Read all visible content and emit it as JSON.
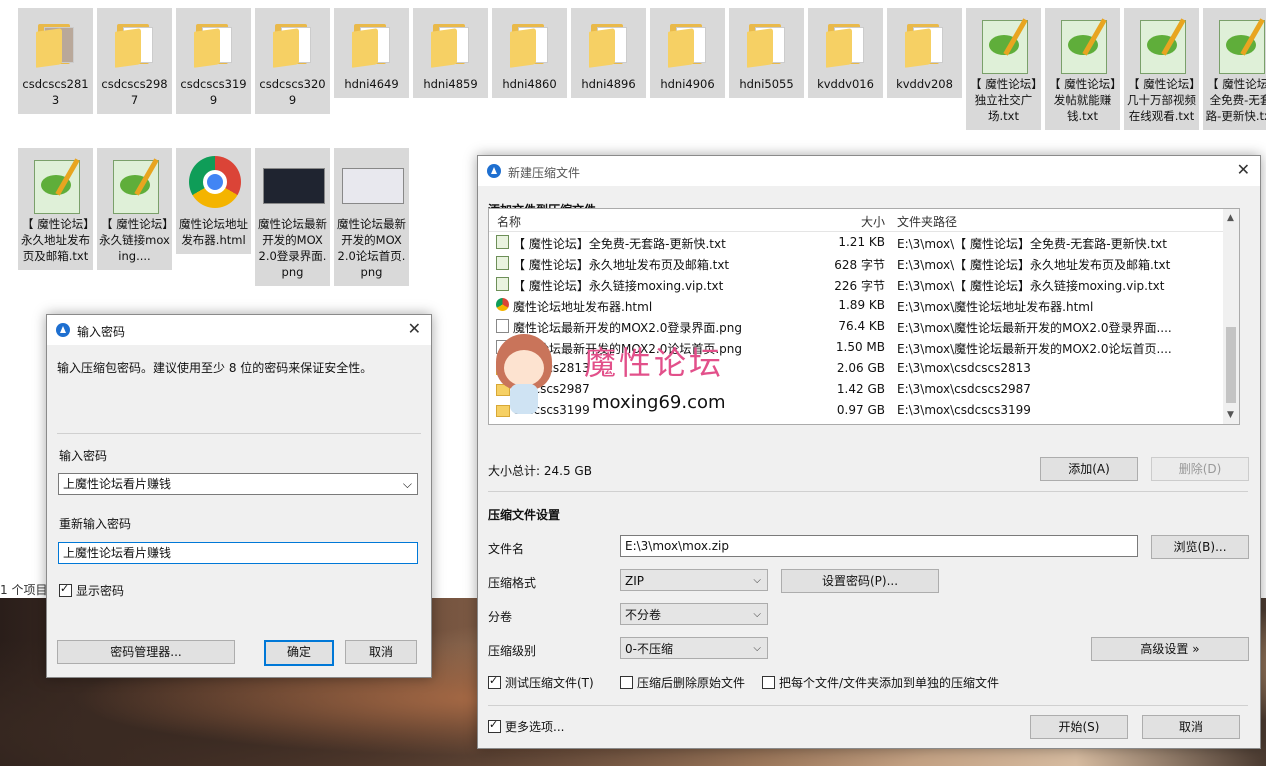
{
  "explorer": {
    "row1": [
      {
        "label": "csdcscs2813",
        "type": "folder-photo"
      },
      {
        "label": "csdcscs2987",
        "type": "folder"
      },
      {
        "label": "csdcscs3199",
        "type": "folder"
      },
      {
        "label": "csdcscs3209",
        "type": "folder"
      },
      {
        "label": "hdni4649",
        "type": "folder"
      },
      {
        "label": "hdni4859",
        "type": "folder"
      },
      {
        "label": "hdni4860",
        "type": "folder"
      },
      {
        "label": "hdni4896",
        "type": "folder"
      },
      {
        "label": "hdni4906",
        "type": "folder"
      },
      {
        "label": "hdni5055",
        "type": "folder"
      },
      {
        "label": "kvddv016",
        "type": "folder"
      },
      {
        "label": "kvddv208",
        "type": "folder"
      },
      {
        "label": "【 魔性论坛】独立社交广场.txt",
        "type": "notepad"
      },
      {
        "label": "【 魔性论坛】发帖就能赚钱.txt",
        "type": "notepad"
      },
      {
        "label": "【 魔性论坛】几十万部视频在线观看.txt",
        "type": "notepad"
      },
      {
        "label": "【 魔性论坛】全免费-无套路-更新快.txt",
        "type": "notepad"
      }
    ],
    "row2": [
      {
        "label": "【 魔性论坛】永久地址发布页及邮箱.txt",
        "type": "notepad"
      },
      {
        "label": "【 魔性论坛】永久链接moxing....",
        "type": "notepad"
      },
      {
        "label": "魔性论坛地址发布器.html",
        "type": "chrome"
      },
      {
        "label": "魔性论坛最新开发的MOX2.0登录界面.png",
        "type": "shot-dark"
      },
      {
        "label": "魔性论坛最新开发的MOX2.0论坛首页.png",
        "type": "shot-light"
      }
    ],
    "status_count": "1 个项目"
  },
  "password_dialog": {
    "title": "输入密码",
    "description": "输入压缩包密码。建议使用至少 8 位的密码来保证安全性。",
    "password_label": "输入密码",
    "password_value": "上魔性论坛看片赚钱",
    "reenter_label": "重新输入密码",
    "reenter_value": "上魔性论坛看片赚钱",
    "show_password_label": "显示密码",
    "show_password_checked": true,
    "manager_button": "密码管理器...",
    "ok_button": "确定",
    "cancel_button": "取消"
  },
  "archive_dialog": {
    "title": "新建压缩文件",
    "section_add": "添加文件到压缩文件",
    "columns": {
      "name": "名称",
      "size": "大小",
      "path": "文件夹路径"
    },
    "files": [
      {
        "icon": "txt",
        "name": "【 魔性论坛】全免费-无套路-更新快.txt",
        "size": "1.21 KB",
        "path": "E:\\3\\mox\\【 魔性论坛】全免费-无套路-更新快.txt"
      },
      {
        "icon": "txt",
        "name": "【 魔性论坛】永久地址发布页及邮箱.txt",
        "size": "628 字节",
        "path": "E:\\3\\mox\\【 魔性论坛】永久地址发布页及邮箱.txt"
      },
      {
        "icon": "txt",
        "name": "【 魔性论坛】永久链接moxing.vip.txt",
        "size": "226 字节",
        "path": "E:\\3\\mox\\【 魔性论坛】永久链接moxing.vip.txt"
      },
      {
        "icon": "html",
        "name": "魔性论坛地址发布器.html",
        "size": "1.89 KB",
        "path": "E:\\3\\mox\\魔性论坛地址发布器.html"
      },
      {
        "icon": "png",
        "name": "魔性论坛最新开发的MOX2.0登录界面.png",
        "size": "76.4 KB",
        "path": "E:\\3\\mox\\魔性论坛最新开发的MOX2.0登录界面...."
      },
      {
        "icon": "png",
        "name": "魔性论坛最新开发的MOX2.0论坛首页.png",
        "size": "1.50 MB",
        "path": "E:\\3\\mox\\魔性论坛最新开发的MOX2.0论坛首页...."
      },
      {
        "icon": "folder",
        "name": "csdcscs2813",
        "size": "2.06 GB",
        "path": "E:\\3\\mox\\csdcscs2813"
      },
      {
        "icon": "folder",
        "name": "csdcscs2987",
        "size": "1.42 GB",
        "path": "E:\\3\\mox\\csdcscs2987"
      },
      {
        "icon": "folder",
        "name": "csdcscs3199",
        "size": "0.97 GB",
        "path": "E:\\3\\mox\\csdcscs3199"
      }
    ],
    "total_size": "大小总计: 24.5 GB",
    "add_button": "添加(A)",
    "delete_button": "删除(D)",
    "section_settings": "压缩文件设置",
    "filename_label": "文件名",
    "filename_value": "E:\\3\\mox\\mox.zip",
    "browse_button": "浏览(B)...",
    "format_label": "压缩格式",
    "format_value": "ZIP",
    "set_password_button": "设置密码(P)...",
    "volume_label": "分卷",
    "volume_value": "不分卷",
    "level_label": "压缩级别",
    "level_value": "0-不压缩",
    "advanced_button": "高级设置 »",
    "test_archive_label": "测试压缩文件(T)",
    "test_archive_checked": true,
    "delete_source_label": "压缩后删除原始文件",
    "delete_source_checked": false,
    "separate_label": "把每个文件/文件夹添加到单独的压缩文件",
    "separate_checked": false,
    "more_options_label": "更多选项...",
    "more_options_checked": true,
    "start_button": "开始(S)",
    "cancel_button": "取消"
  },
  "watermark": {
    "title": "魔性论坛",
    "url": "moxing69.com"
  }
}
